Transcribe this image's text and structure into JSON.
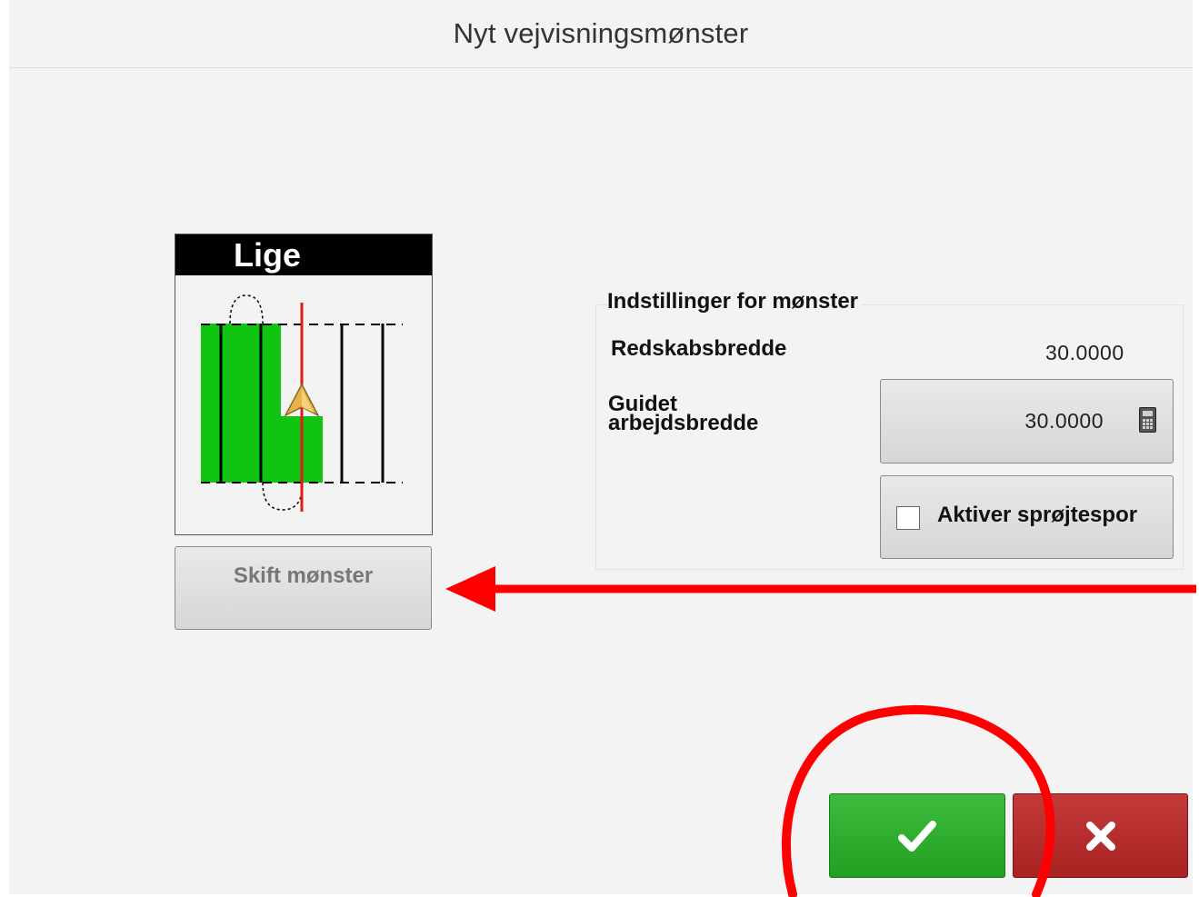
{
  "dialog": {
    "title": "Nyt vejvisningsmønster"
  },
  "pattern": {
    "name": "Lige",
    "change_button_label": "Skift mønster"
  },
  "settings": {
    "group_title": "Indstillinger for mønster",
    "implement_width_label": "Redskabsbredde",
    "implement_width_value": "30.0000",
    "guided_width_label": "Guidet arbejdsbredde",
    "guided_width_value": "30.0000",
    "spray_track_label": "Aktiver sprøjtespor",
    "spray_track_checked": false
  },
  "actions": {
    "confirm_icon": "checkmark-icon",
    "cancel_icon": "close-icon"
  },
  "colors": {
    "confirm": "#2aaa2a",
    "cancel": "#b22a2a",
    "annotation": "#ff0000",
    "pattern_fill": "#11c411"
  },
  "annotations": {
    "arrow_icon": "left-arrow-annotation",
    "circle_icon": "circle-annotation"
  }
}
